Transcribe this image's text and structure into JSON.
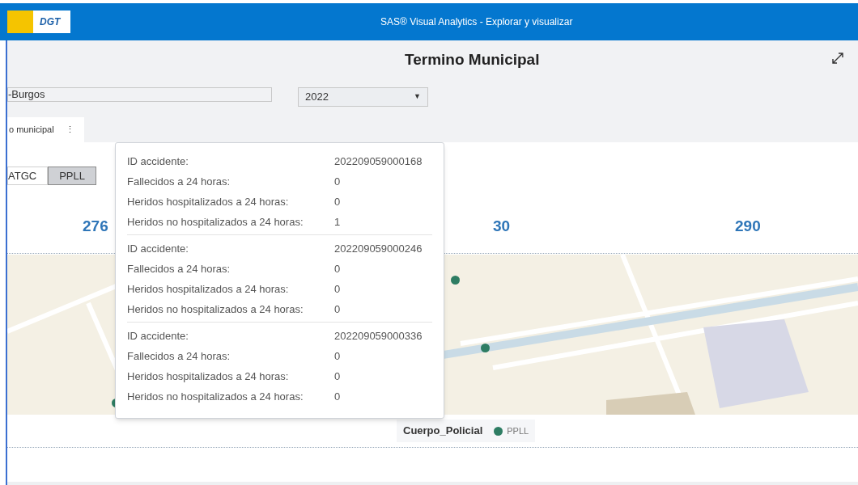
{
  "header": {
    "logo_text": "DGT",
    "title": "SAS® Visual Analytics - Explorar y visualizar"
  },
  "page": {
    "title": "Termino Municipal"
  },
  "filters": {
    "municipality": "-Burgos",
    "year": "2022",
    "dropdown_arrow": "▼"
  },
  "tabs": [
    {
      "label": "o municipal",
      "selected": true,
      "menu": "⋮"
    }
  ],
  "toggle": [
    {
      "label": "ATGC",
      "selected": false
    },
    {
      "label": "PPLL",
      "selected": true
    }
  ],
  "kpis": [
    "276",
    "30",
    "290"
  ],
  "map": {
    "markers": [
      {
        "color": "#2e7d63"
      }
    ]
  },
  "legend": {
    "title": "Cuerpo_Policial",
    "items": [
      {
        "label": "PPLL",
        "color": "#2e7d63"
      }
    ]
  },
  "tooltip": [
    {
      "rows": [
        {
          "label": "ID accidente:",
          "value": "202209059000168"
        },
        {
          "label": "Fallecidos a 24 horas:",
          "value": "0"
        },
        {
          "label": "Heridos hospitalizados a 24 horas:",
          "value": "0"
        },
        {
          "label": "Heridos no hospitalizados a 24 horas:",
          "value": "1"
        }
      ]
    },
    {
      "rows": [
        {
          "label": "ID accidente:",
          "value": "202209059000246"
        },
        {
          "label": "Fallecidos a 24 horas:",
          "value": "0"
        },
        {
          "label": "Heridos hospitalizados a 24 horas:",
          "value": "0"
        },
        {
          "label": "Heridos no hospitalizados a 24 horas:",
          "value": "0"
        }
      ]
    },
    {
      "rows": [
        {
          "label": "ID accidente:",
          "value": "202209059000336"
        },
        {
          "label": "Fallecidos a 24 horas:",
          "value": "0"
        },
        {
          "label": "Heridos hospitalizados a 24 horas:",
          "value": "0"
        },
        {
          "label": "Heridos no hospitalizados a 24 horas:",
          "value": "0"
        }
      ]
    }
  ]
}
